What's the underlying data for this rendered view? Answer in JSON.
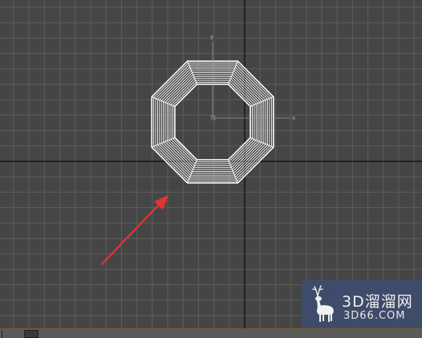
{
  "viewport": {
    "background": "#454545",
    "grid_color": "#5d5d5d",
    "home_axis_color": "#0a0a0a",
    "gizmo_labels": {
      "x": "x",
      "y": "y"
    },
    "object": {
      "shape": "octagon",
      "sides": 8,
      "wire_color": "#ffffff"
    },
    "arrow_color": "#e53333"
  },
  "watermark": {
    "title": "3D溜溜网",
    "url": "3D66.COM",
    "background": "#3e4c6e",
    "logo_icon": "deer-icon"
  },
  "timeline": {
    "background": "#5a5a5a"
  }
}
